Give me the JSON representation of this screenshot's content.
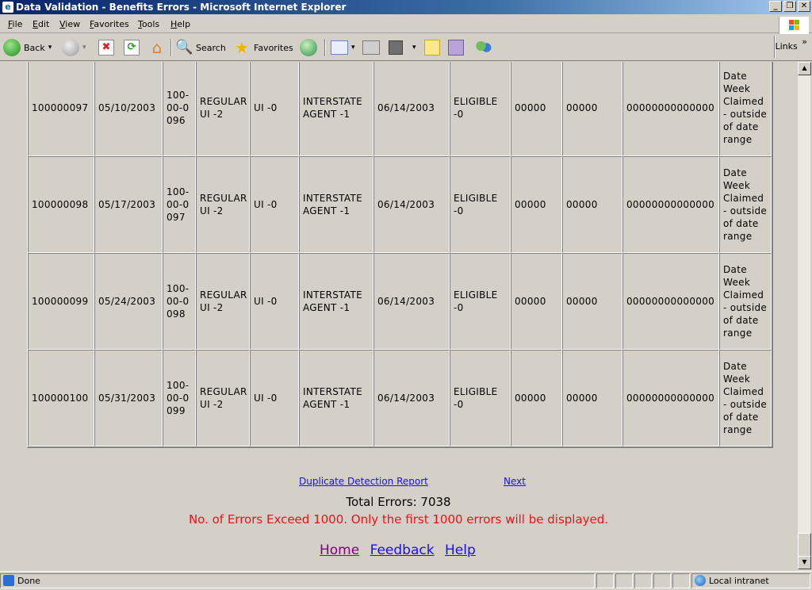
{
  "window": {
    "title": "Data Validation - Benefits Errors - Microsoft Internet Explorer",
    "app_icon": "e",
    "minimize": "_",
    "maximize": "❐",
    "close": "✕"
  },
  "menu": [
    "File",
    "Edit",
    "View",
    "Favorites",
    "Tools",
    "Help"
  ],
  "toolbar": {
    "back_label": "Back",
    "search_label": "Search",
    "favorites_label": "Favorites",
    "links_label": "Links",
    "links_chevron": "»",
    "dropdown_arrow": "▾"
  },
  "table": {
    "rows": [
      {
        "id": "100000097",
        "date": "05/10/2003",
        "ssn": "100-00-0096",
        "program": "REGULAR UI -2",
        "ui": "UI -0",
        "agent": "INTERSTATE AGENT -1",
        "claim_date": "06/14/2003",
        "status": "ELIGIBLE -0",
        "code1": "00000",
        "code2": "00000",
        "long_code": "00000000000000",
        "error": "Date Week Claimed - outside of date range"
      },
      {
        "id": "100000098",
        "date": "05/17/2003",
        "ssn": "100-00-0097",
        "program": "REGULAR UI -2",
        "ui": "UI -0",
        "agent": "INTERSTATE AGENT -1",
        "claim_date": "06/14/2003",
        "status": "ELIGIBLE -0",
        "code1": "00000",
        "code2": "00000",
        "long_code": "00000000000000",
        "error": "Date Week Claimed - outside of date range"
      },
      {
        "id": "100000099",
        "date": "05/24/2003",
        "ssn": "100-00-0098",
        "program": "REGULAR UI -2",
        "ui": "UI -0",
        "agent": "INTERSTATE AGENT -1",
        "claim_date": "06/14/2003",
        "status": "ELIGIBLE -0",
        "code1": "00000",
        "code2": "00000",
        "long_code": "00000000000000",
        "error": "Date Week Claimed - outside of date range"
      },
      {
        "id": "100000100",
        "date": "05/31/2003",
        "ssn": "100-00-0099",
        "program": "REGULAR UI -2",
        "ui": "UI -0",
        "agent": "INTERSTATE AGENT -1",
        "claim_date": "06/14/2003",
        "status": "ELIGIBLE -0",
        "code1": "00000",
        "code2": "00000",
        "long_code": "00000000000000",
        "error": "Date Week Claimed - outside of date range"
      }
    ]
  },
  "footer": {
    "duplicate_link": "Duplicate Detection Report",
    "next_link": "Next",
    "total_errors": "Total Errors: 7038",
    "warning": "No. of Errors Exceed 1000. Only the first 1000 errors will be displayed.",
    "home": "Home",
    "feedback": "Feedback",
    "help": "Help"
  },
  "status": {
    "text": "Done",
    "zone": "Local intranet"
  },
  "scrollbar": {
    "up": "▲",
    "down": "▼"
  },
  "colors": {
    "link": "#1a0dff",
    "visited": "#800080",
    "warning": "#e8151b",
    "titlebar": "#0a246a"
  }
}
